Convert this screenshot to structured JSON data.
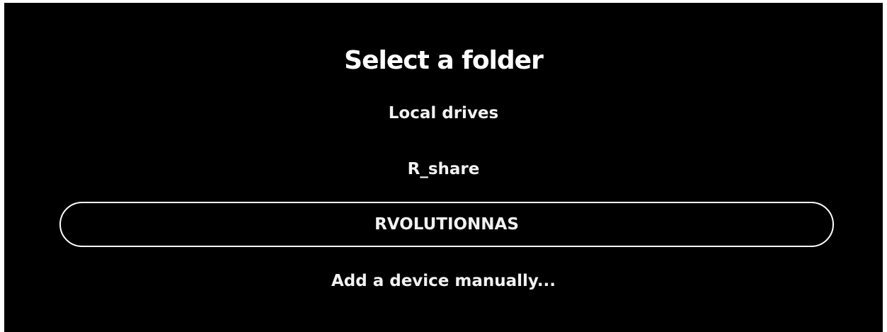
{
  "dialog": {
    "title": "Select a folder",
    "items": [
      {
        "label": "Local drives",
        "selected": false
      },
      {
        "label": "R_share",
        "selected": false
      },
      {
        "label": "RVOLUTIONNAS",
        "selected": true
      },
      {
        "label": "Add a device manually...",
        "selected": false
      }
    ]
  },
  "colors": {
    "background": "#000000",
    "text": "#ffffff",
    "selection_border": "#ffffff"
  }
}
